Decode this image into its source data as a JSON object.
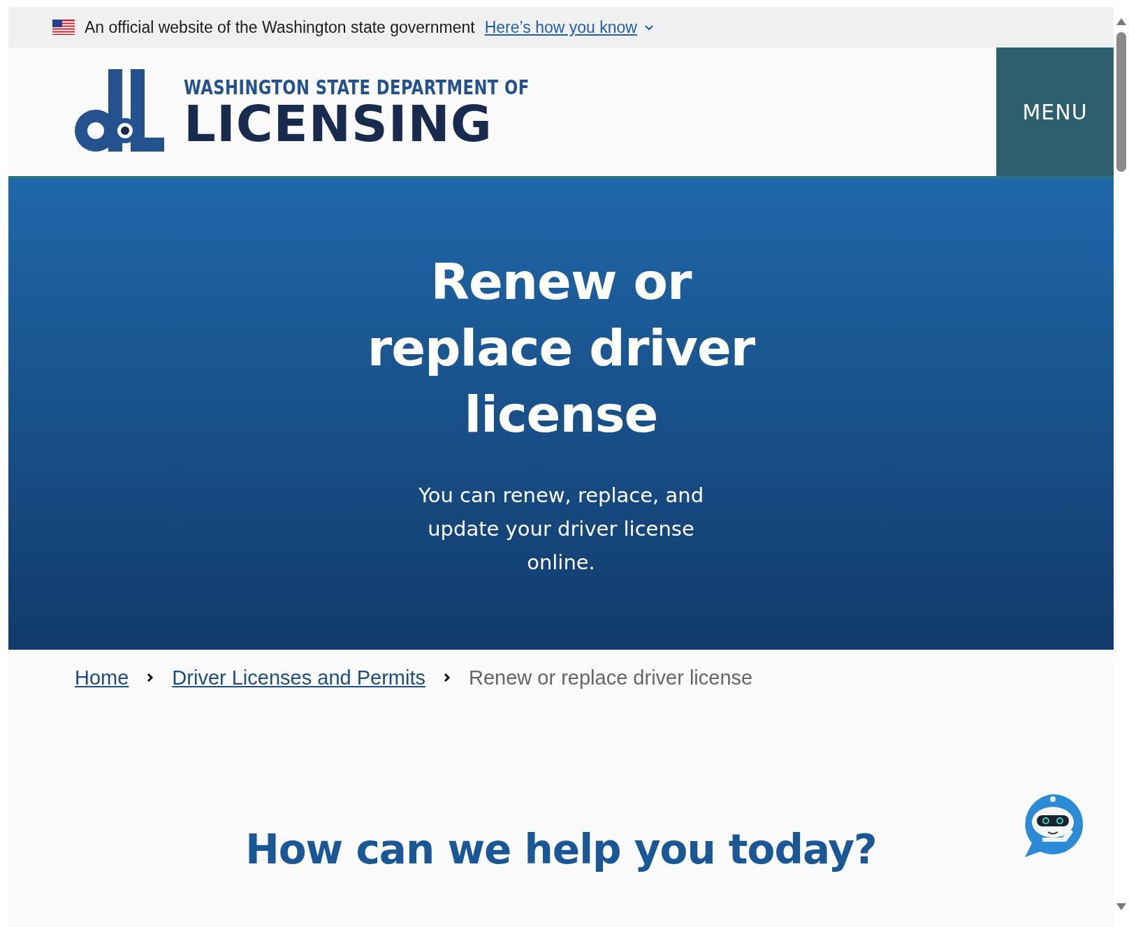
{
  "banner": {
    "text": "An official website of the Washington state government",
    "link": "Here’s how you know",
    "expanded": false
  },
  "header": {
    "logo_line1": "WASHINGTON STATE DEPARTMENT OF",
    "logo_line2": "LICENSING",
    "menu": "MENU"
  },
  "hero": {
    "title": "Renew or replace driver license",
    "subtitle": "You can renew, replace, and update your driver license online."
  },
  "breadcrumb": [
    {
      "label": "Home",
      "kind": "link"
    },
    {
      "label": "Driver Licenses and Permits",
      "kind": "link"
    },
    {
      "label": "Renew or replace driver license",
      "kind": "current"
    }
  ],
  "section": {
    "heading": "How can we help you today?"
  }
}
